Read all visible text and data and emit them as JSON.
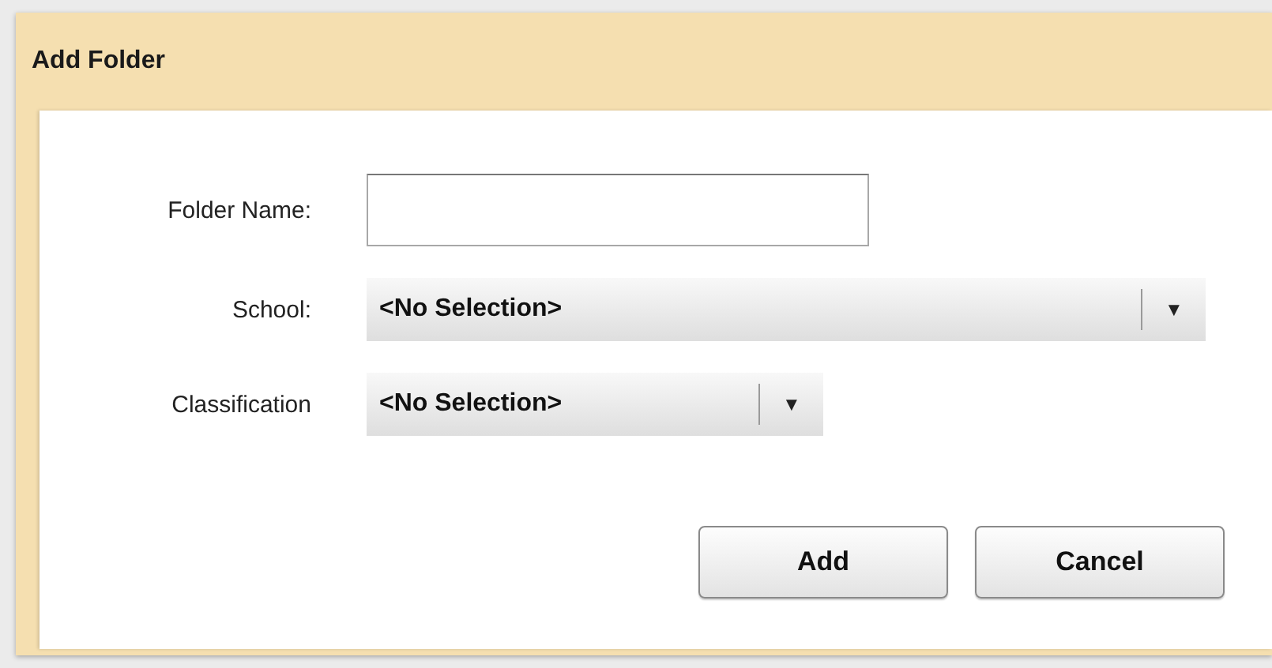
{
  "window": {
    "title": "Add Folder"
  },
  "fields": [
    {
      "kind": "text",
      "label": "Folder Name:"
    },
    {
      "kind": "select",
      "label": "School:",
      "value": "<No Selection>",
      "arrow": "▼",
      "wide": true
    },
    {
      "kind": "select",
      "label": "Classification",
      "value": "<No Selection>",
      "arrow": "▼",
      "wide": false
    }
  ],
  "buttons": [
    "Add",
    "Cancel"
  ]
}
